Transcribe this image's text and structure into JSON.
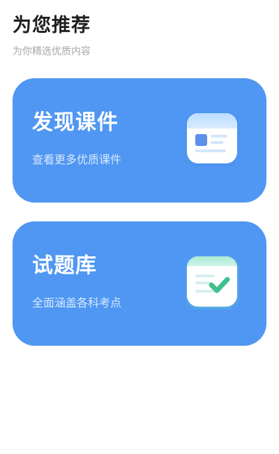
{
  "header": {
    "title": "为您推荐",
    "subtitle": "为你精选优质内容"
  },
  "cards": [
    {
      "title": "发现课件",
      "description": "查看更多优质课件",
      "icon": "courseware-icon",
      "color": "#4f97f2"
    },
    {
      "title": "试题库",
      "description": "全面涵盖各科考点",
      "icon": "question-bank-icon",
      "color": "#4f97f2"
    }
  ]
}
